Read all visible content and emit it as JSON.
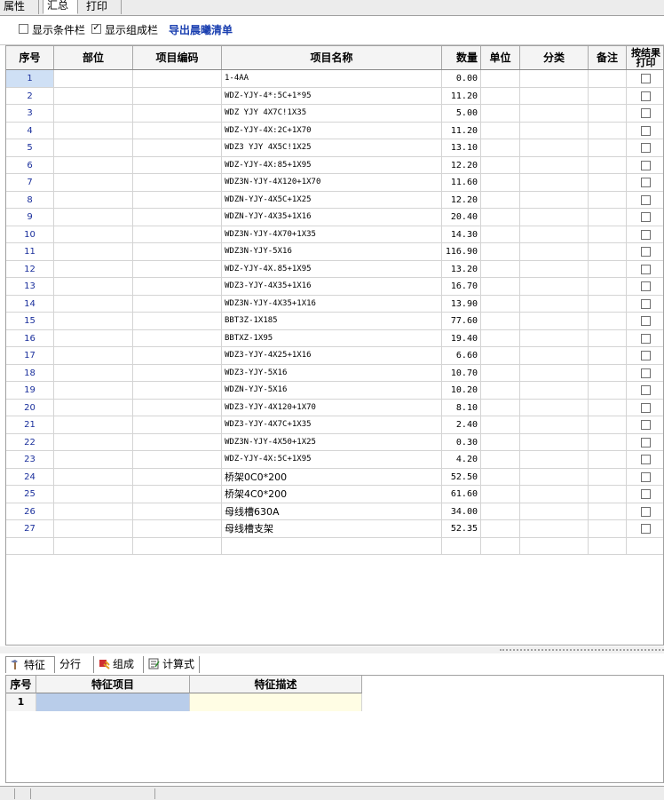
{
  "top_tabs": [
    "属性",
    "汇总",
    "打印"
  ],
  "toolbar": {
    "show_condition_label": "显示条件栏",
    "show_condition_checked": false,
    "show_group_label": "显示组成栏",
    "show_group_checked": true,
    "export_label": "导出晨曦清单"
  },
  "grid": {
    "headers": {
      "seq": "序号",
      "part": "部位",
      "code": "项目编码",
      "name": "项目名称",
      "qty": "数量",
      "unit": "单位",
      "category": "分类",
      "remark": "备注",
      "print_line1": "按结果",
      "print_line2": "打印"
    },
    "rows": [
      {
        "seq": "1",
        "name": "1-4AA",
        "qty": "0.00"
      },
      {
        "seq": "2",
        "name": "WDZ-YJY-4*:5C+1*95",
        "qty": "11.20"
      },
      {
        "seq": "3",
        "name": "WDZ YJY 4X7C!1X35",
        "qty": "5.00"
      },
      {
        "seq": "4",
        "name": "WDZ-YJY-4X:2C+1X70",
        "qty": "11.20"
      },
      {
        "seq": "5",
        "name": "WDZ3 YJY 4X5C!1X25",
        "qty": "13.10"
      },
      {
        "seq": "6",
        "name": "WDZ-YJY-4X:85+1X95",
        "qty": "12.20"
      },
      {
        "seq": "7",
        "name": "WDZ3N-YJY-4X120+1X70",
        "qty": "11.60"
      },
      {
        "seq": "8",
        "name": "WDZN-YJY-4X5C+1X25",
        "qty": "12.20"
      },
      {
        "seq": "9",
        "name": "WDZN-YJY-4X35+1X16",
        "qty": "20.40"
      },
      {
        "seq": "10",
        "name": "WDZ3N-YJY-4X70+1X35",
        "qty": "14.30"
      },
      {
        "seq": "11",
        "name": "WDZ3N-YJY-5X16",
        "qty": "116.90"
      },
      {
        "seq": "12",
        "name": "WDZ-YJY-4X.85+1X95",
        "qty": "13.20"
      },
      {
        "seq": "13",
        "name": "WDZ3-YJY-4X35+1X16",
        "qty": "16.70"
      },
      {
        "seq": "14",
        "name": "WDZ3N-YJY-4X35+1X16",
        "qty": "13.90"
      },
      {
        "seq": "15",
        "name": "BBT3Z-1X185",
        "qty": "77.60"
      },
      {
        "seq": "16",
        "name": "BBTXZ-1X95",
        "qty": "19.40"
      },
      {
        "seq": "17",
        "name": "WDZ3-YJY-4X25+1X16",
        "qty": "6.60"
      },
      {
        "seq": "18",
        "name": "WDZ3-YJY-5X16",
        "qty": "10.70"
      },
      {
        "seq": "19",
        "name": "WDZN-YJY-5X16",
        "qty": "10.20"
      },
      {
        "seq": "20",
        "name": "WDZ3-YJY-4X120+1X70",
        "qty": "8.10"
      },
      {
        "seq": "21",
        "name": "WDZ3-YJY-4X7C+1X35",
        "qty": "2.40"
      },
      {
        "seq": "22",
        "name": "WDZ3N-YJY-4X50+1X25",
        "qty": "0.30"
      },
      {
        "seq": "23",
        "name": "WDZ-YJY-4X:5C+1X95",
        "qty": "4.20"
      },
      {
        "seq": "24",
        "name": "桥架0C0*200",
        "qty": "52.50"
      },
      {
        "seq": "25",
        "name": "桥架4C0*200",
        "qty": "61.60"
      },
      {
        "seq": "26",
        "name": "母线槽630A",
        "qty": "34.00"
      },
      {
        "seq": "27",
        "name": "母线槽支架",
        "qty": "52.35"
      }
    ]
  },
  "bottom_tabs": [
    "特征",
    "分行",
    "组成",
    "计算式"
  ],
  "feature_grid": {
    "headers": {
      "seq": "序号",
      "item": "特征项目",
      "desc": "特征描述"
    },
    "rows": [
      {
        "seq": "1",
        "item": "",
        "desc": ""
      }
    ]
  },
  "colors": {
    "seq_text": "#1a2f9c",
    "selected_row": "#cfe0f5",
    "feature_item_cell": "#b9cdea",
    "feature_desc_cell": "#fffde4",
    "export_link": "#1a3fb0"
  }
}
